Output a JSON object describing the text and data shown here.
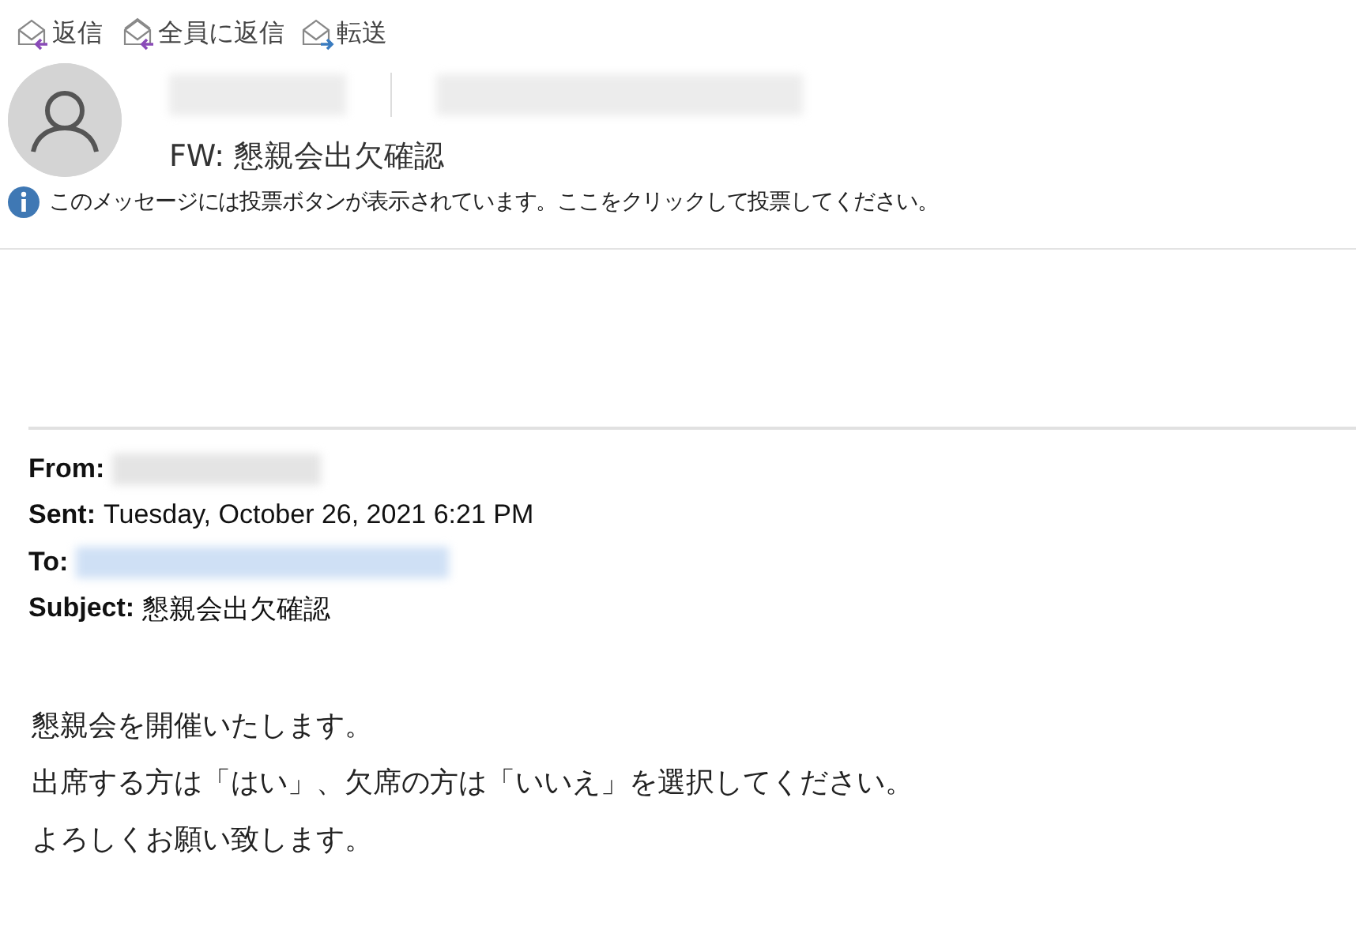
{
  "toolbar": [
    {
      "kind": "reply",
      "label": "返信"
    },
    {
      "kind": "reply-all",
      "label": "全員に返信"
    },
    {
      "kind": "forward",
      "label": "転送"
    }
  ],
  "message": {
    "subject": "FW: 懇親会出欠確認",
    "info": "このメッセージには投票ボタンが表示されています。ここをクリックして投票してください。"
  },
  "forwarded_header": [
    {
      "label": "From:",
      "kind": "redacted"
    },
    {
      "label": "Sent:",
      "kind": "text",
      "value": "Tuesday, October 26, 2021 6:21 PM"
    },
    {
      "label": "To:",
      "kind": "redacted-link"
    },
    {
      "label": "Subject:",
      "kind": "text",
      "value": "懇親会出欠確認"
    }
  ],
  "body": [
    "懇親会を開催いたします。",
    "出席する方は「はい」、欠席の方は「いいえ」を選択してください。",
    "よろしくお願い致します。"
  ]
}
